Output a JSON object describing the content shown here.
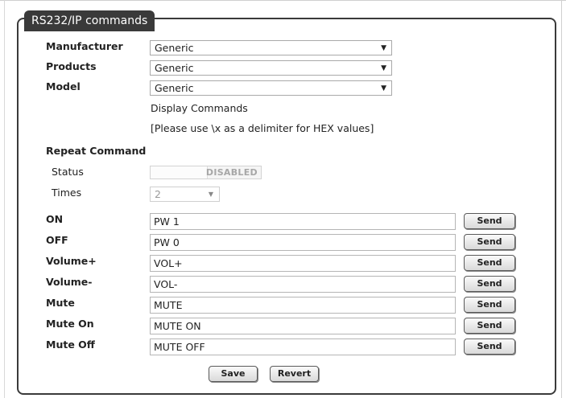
{
  "panel": {
    "title": "RS232/IP commands"
  },
  "fields": {
    "manufacturer": {
      "label": "Manufacturer",
      "value": "Generic"
    },
    "products": {
      "label": "Products",
      "value": "Generic"
    },
    "model": {
      "label": "Model",
      "value": "Generic"
    }
  },
  "display_commands": "Display Commands",
  "hex_note": "[Please use \\x as a delimiter for HEX values]",
  "repeat": {
    "heading": "Repeat Command",
    "status_label": "Status",
    "status_value": "DISABLED",
    "times_label": "Times",
    "times_value": "2"
  },
  "commands": [
    {
      "label": "ON",
      "value": "PW 1",
      "button": "Send"
    },
    {
      "label": "OFF",
      "value": "PW 0",
      "button": "Send"
    },
    {
      "label": "Volume+",
      "value": "VOL+",
      "button": "Send"
    },
    {
      "label": "Volume-",
      "value": "VOL-",
      "button": "Send"
    },
    {
      "label": "Mute",
      "value": "MUTE",
      "button": "Send"
    },
    {
      "label": "Mute On",
      "value": "MUTE ON",
      "button": "Send"
    },
    {
      "label": "Mute Off",
      "value": "MUTE OFF",
      "button": "Send"
    }
  ],
  "actions": {
    "save": "Save",
    "revert": "Revert"
  }
}
